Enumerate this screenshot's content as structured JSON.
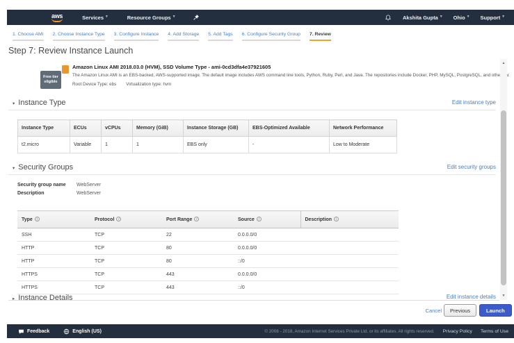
{
  "topnav": {
    "logo_text": "aws",
    "services_label": "Services",
    "resource_groups_label": "Resource Groups",
    "user_label": "Akshita Gupta",
    "region_label": "Ohio",
    "support_label": "Support"
  },
  "steps": [
    {
      "label": "1. Choose AMI",
      "active": false
    },
    {
      "label": "2. Choose Instance Type",
      "active": false
    },
    {
      "label": "3. Configure Instance",
      "active": false
    },
    {
      "label": "4. Add Storage",
      "active": false
    },
    {
      "label": "5. Add Tags",
      "active": false
    },
    {
      "label": "6. Configure Security Group",
      "active": false
    },
    {
      "label": "7. Review",
      "active": true
    }
  ],
  "page_title": "Step 7: Review Instance Launch",
  "ami": {
    "badge_line1": "Free tier",
    "badge_line2": "eligible",
    "title": "Amazon Linux AMI 2018.03.0 (HVM), SSD Volume Type - ami-0cd3dfa4e37921605",
    "description": "The Amazon Linux AMI is an EBS-backed, AWS-supported image. The default image includes AWS command line tools, Python, Ruby, Perl, and Java. The repositories include Docker, PHP, MySQL, PostgreSQL, and other packages.",
    "root_device_label": "Root Device Type:",
    "root_device_value": "ebs",
    "virtualization_label": "Virtualization type:",
    "virtualization_value": "hvm"
  },
  "instance_type": {
    "section_title": "Instance Type",
    "edit_link": "Edit instance type",
    "headers": [
      "Instance Type",
      "ECUs",
      "vCPUs",
      "Memory (GiB)",
      "Instance Storage (GB)",
      "EBS-Optimized Available",
      "Network Performance"
    ],
    "row": [
      "t2.micro",
      "Variable",
      "1",
      "1",
      "EBS only",
      "-",
      "Low to Moderate"
    ]
  },
  "security_groups": {
    "section_title": "Security Groups",
    "edit_link": "Edit security groups",
    "name_label": "Security group name",
    "name_value": "WebServer",
    "desc_label": "Description",
    "desc_value": "WebServer",
    "headers": [
      "Type",
      "Protocol",
      "Port Range",
      "Source",
      "Description"
    ],
    "rows": [
      [
        "SSH",
        "TCP",
        "22",
        "0.0.0.0/0",
        ""
      ],
      [
        "HTTP",
        "TCP",
        "80",
        "0.0.0.0/0",
        ""
      ],
      [
        "HTTP",
        "TCP",
        "80",
        "::/0",
        ""
      ],
      [
        "HTTPS",
        "TCP",
        "443",
        "0.0.0.0/0",
        ""
      ],
      [
        "HTTPS",
        "TCP",
        "443",
        "::/0",
        ""
      ]
    ]
  },
  "instance_details": {
    "section_title": "Instance Details",
    "edit_link": "Edit instance details"
  },
  "actions": {
    "cancel": "Cancel",
    "previous": "Previous",
    "launch": "Launch"
  },
  "footer": {
    "feedback": "Feedback",
    "language": "English (US)",
    "copyright": "© 2008 - 2018, Amazon Internet Services Private Ltd. or its affiliates. All rights reserved.",
    "privacy": "Privacy Policy",
    "terms": "Terms of Use"
  },
  "icons": {
    "caret_down": "▾",
    "section_expanded": "▾",
    "section_collapsed": "▸",
    "scroll_up": "▲",
    "scroll_down": "▼",
    "info": "i"
  },
  "colors": {
    "navbar_bg": "#232f3e",
    "accent_orange": "#f0a12c",
    "link_blue": "#4a7ec0",
    "launch_button": "#3c5dc9",
    "ami_icon_orange": "#e8972d",
    "free_tier_badge": "#5f6b76"
  }
}
